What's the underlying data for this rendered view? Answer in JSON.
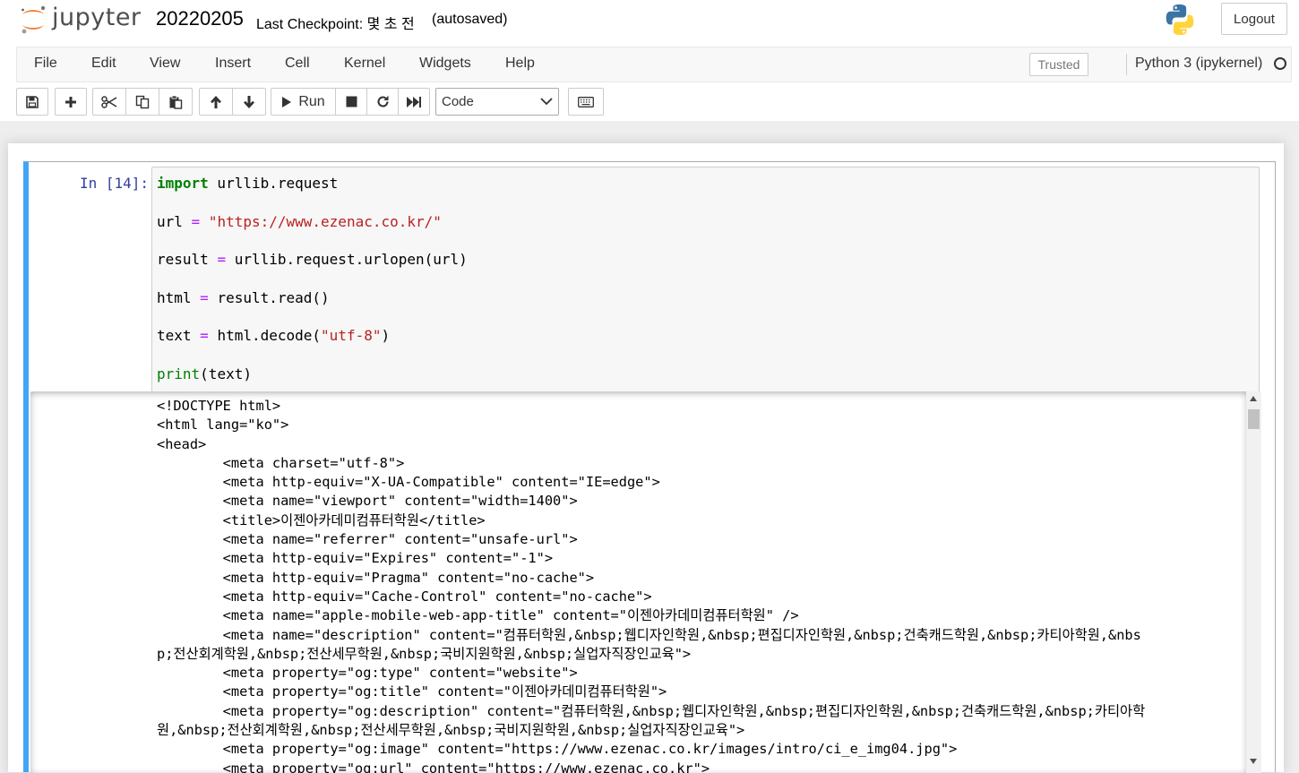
{
  "header": {
    "logo_text": "jupyter",
    "notebook_name": "20220205",
    "checkpoint": "Last Checkpoint: 몇 초 전",
    "autosave": "(autosaved)",
    "logout_label": "Logout"
  },
  "menubar": {
    "items": [
      "File",
      "Edit",
      "View",
      "Insert",
      "Cell",
      "Kernel",
      "Widgets",
      "Help"
    ],
    "trusted_label": "Trusted",
    "kernel_name": "Python 3 (ipykernel)"
  },
  "toolbar": {
    "buttons": [
      "save-icon",
      "plus-icon",
      "scissors-icon",
      "copy-icon",
      "paste-icon",
      "arrow-up-icon",
      "arrow-down-icon",
      "play-icon",
      "stop-icon",
      "restart-icon",
      "fast-forward-icon",
      "keyboard-icon"
    ],
    "run_label": "Run",
    "cell_type": "Code"
  },
  "cell": {
    "prompt": "In [14]:",
    "code_lines": [
      "import urllib.request",
      "url = \"https://www.ezenac.co.kr/\"",
      "result = urllib.request.urlopen(url)",
      "html = result.read()",
      "text = html.decode(\"utf-8\")",
      "print(text)"
    ],
    "output_lines": [
      "<!DOCTYPE html>",
      "<html lang=\"ko\">",
      "<head>",
      "\t<meta charset=\"utf-8\">",
      "\t<meta http-equiv=\"X-UA-Compatible\" content=\"IE=edge\">",
      "\t<meta name=\"viewport\" content=\"width=1400\">",
      "\t<title>이젠아카데미컴퓨터학원</title>",
      "\t<meta name=\"referrer\" content=\"unsafe-url\">",
      "\t<meta http-equiv=\"Expires\" content=\"-1\">",
      "\t<meta http-equiv=\"Pragma\" content=\"no-cache\">",
      "\t<meta http-equiv=\"Cache-Control\" content=\"no-cache\">",
      "\t<meta name=\"apple-mobile-web-app-title\" content=\"이젠아카데미컴퓨터학원\" />",
      "\t<meta name=\"description\" content=\"컴퓨터학원,&nbsp;웹디자인학원,&nbsp;편집디자인학원,&nbsp;건축캐드학원,&nbsp;카티아학원,&nbs",
      "p;전산회계학원,&nbsp;전산세무학원,&nbsp;국비지원학원,&nbsp;실업자직장인교육\">",
      "\t<meta property=\"og:type\" content=\"website\">",
      "\t<meta property=\"og:title\" content=\"이젠아카데미컴퓨터학원\">",
      "\t<meta property=\"og:description\" content=\"컴퓨터학원,&nbsp;웹디자인학원,&nbsp;편집디자인학원,&nbsp;건축캐드학원,&nbsp;카티아학",
      "원,&nbsp;전산회계학원,&nbsp;전산세무학원,&nbsp;국비지원학원,&nbsp;실업자직장인교육\">",
      "\t<meta property=\"og:image\" content=\"https://www.ezenac.co.kr/images/intro/ci_e_img04.jpg\">",
      "\t<meta property=\"og:url\" content=\"https://www.ezenac.co.kr\">"
    ]
  },
  "colors": {
    "cell_selected_border": "#42a5f5",
    "prompt": "#303f9f",
    "keyword": "#008000",
    "operator": "#aa22ff",
    "string": "#ba2121"
  }
}
